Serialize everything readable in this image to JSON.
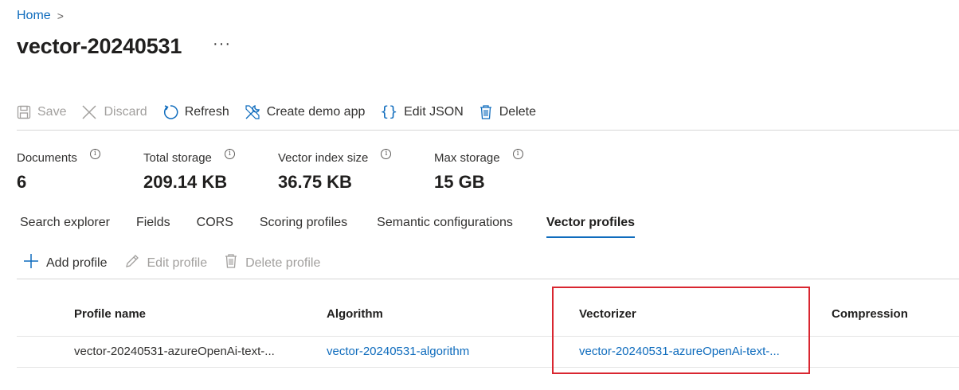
{
  "breadcrumb": {
    "home": "Home",
    "separator": ">"
  },
  "page": {
    "title": "vector-20240531",
    "more": "···"
  },
  "toolbar": {
    "save": "Save",
    "discard": "Discard",
    "refresh": "Refresh",
    "create_demo_app": "Create demo app",
    "edit_json": "Edit JSON",
    "delete": "Delete"
  },
  "stats": [
    {
      "label": "Documents",
      "value": "6"
    },
    {
      "label": "Total storage",
      "value": "209.14 KB"
    },
    {
      "label": "Vector index size",
      "value": "36.75 KB"
    },
    {
      "label": "Max storage",
      "value": "15 GB"
    }
  ],
  "tabs": [
    {
      "label": "Search explorer"
    },
    {
      "label": "Fields"
    },
    {
      "label": "CORS"
    },
    {
      "label": "Scoring profiles"
    },
    {
      "label": "Semantic configurations"
    },
    {
      "label": "Vector profiles",
      "active": true
    }
  ],
  "subtoolbar": {
    "add_profile": "Add profile",
    "edit_profile": "Edit profile",
    "delete_profile": "Delete profile"
  },
  "table": {
    "columns": [
      "Profile name",
      "Algorithm",
      "Vectorizer",
      "Compression"
    ],
    "rows": [
      {
        "profile_name": "vector-20240531-azureOpenAi-text-...",
        "algorithm": "vector-20240531-algorithm",
        "vectorizer": "vector-20240531-azureOpenAi-text-...",
        "compression": ""
      }
    ]
  },
  "colors": {
    "accent": "#0f6cbd",
    "highlight": "#d92630",
    "disabled": "#a19f9d"
  }
}
